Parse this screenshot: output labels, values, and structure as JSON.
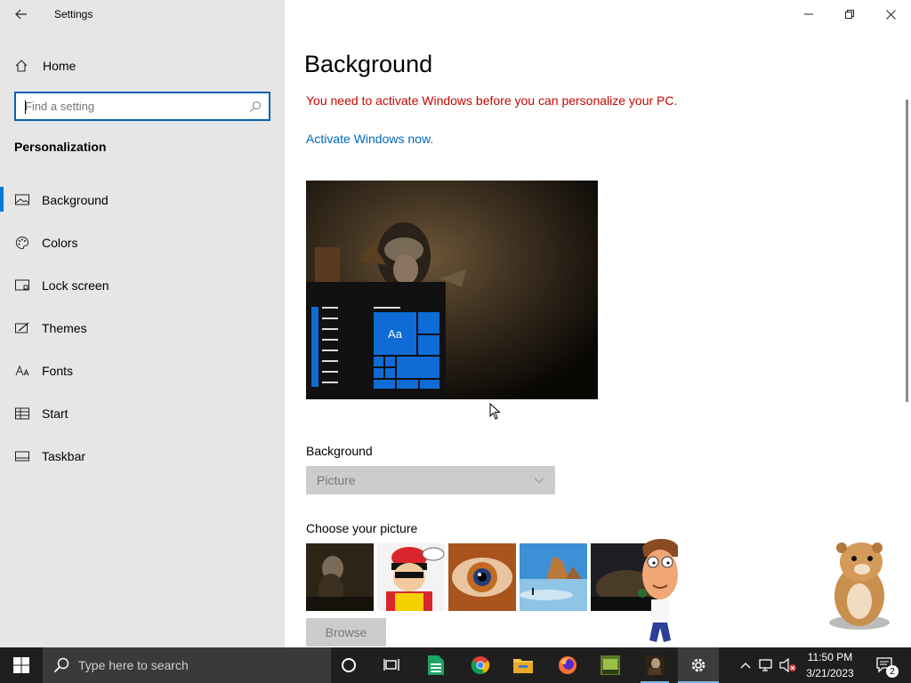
{
  "window": {
    "title": "Settings"
  },
  "sidebar": {
    "home_label": "Home",
    "search_placeholder": "Find a setting",
    "section_title": "Personalization",
    "items": [
      {
        "label": "Background",
        "icon": "picture-icon",
        "active": true
      },
      {
        "label": "Colors",
        "icon": "palette-icon"
      },
      {
        "label": "Lock screen",
        "icon": "lock-screen-icon"
      },
      {
        "label": "Themes",
        "icon": "themes-icon"
      },
      {
        "label": "Fonts",
        "icon": "fonts-icon"
      },
      {
        "label": "Start",
        "icon": "start-icon"
      },
      {
        "label": "Taskbar",
        "icon": "taskbar-icon"
      }
    ]
  },
  "main": {
    "title": "Background",
    "warning": "You need to activate Windows before you can personalize your PC.",
    "activate_link": "Activate Windows now.",
    "preview": {
      "tile_label": "Aa"
    },
    "background_label": "Background",
    "background_value": "Picture",
    "choose_label": "Choose your picture",
    "browse_label": "Browse"
  },
  "taskbar": {
    "search_placeholder": "Type here to search",
    "time": "11:50 PM",
    "date": "3/21/2023",
    "notification_count": "2"
  },
  "colors": {
    "accent": "#0078d7",
    "warning": "#c50500",
    "link": "#0067b8",
    "sidebar_bg": "#e6e6e6",
    "taskbar_bg": "#1f1f1f"
  }
}
